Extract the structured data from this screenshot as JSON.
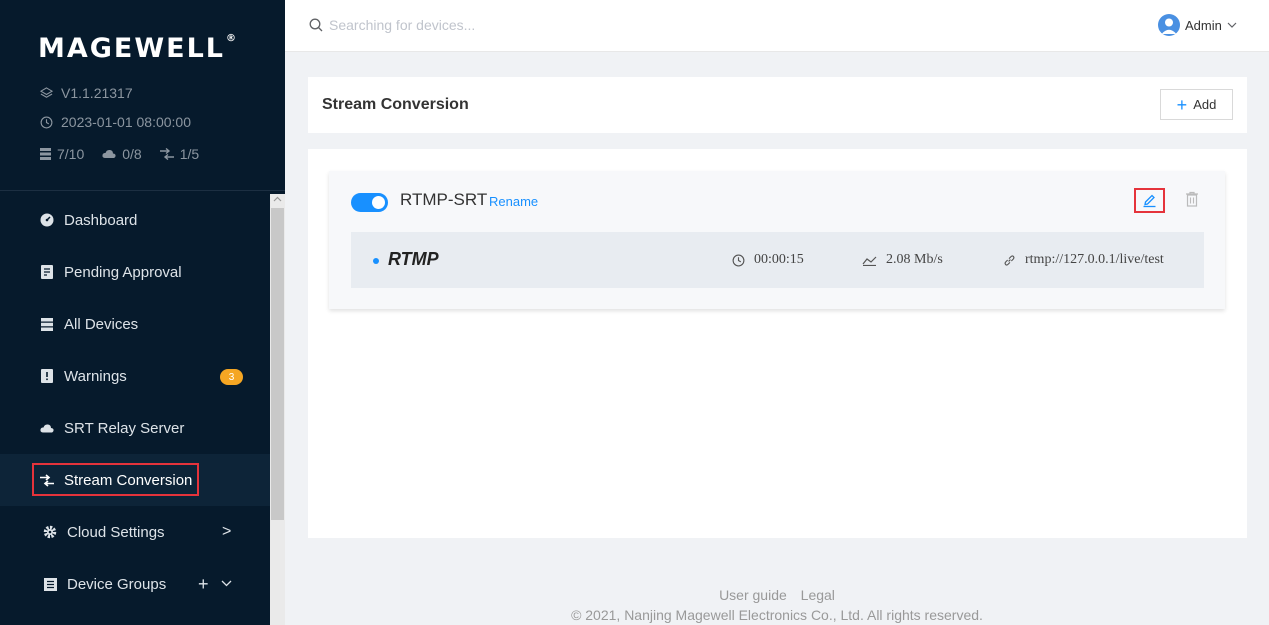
{
  "app": {
    "brand": "MAGEWELL",
    "brand_mark": "®",
    "version": "V1.1.21317",
    "datetime": "2023-01-01 08:00:00",
    "counts": {
      "devices": "7/10",
      "cloud": "0/8",
      "streams": "1/5"
    }
  },
  "sidebar": {
    "items": [
      {
        "label": "Dashboard",
        "icon": "dashboard-icon"
      },
      {
        "label": "Pending Approval",
        "icon": "pending-approval-icon"
      },
      {
        "label": "All Devices",
        "icon": "devices-icon"
      },
      {
        "label": "Warnings",
        "icon": "warning-icon",
        "badge": "3"
      },
      {
        "label": "SRT Relay Server",
        "icon": "cloud-icon"
      },
      {
        "label": "Stream Conversion",
        "icon": "stream-conversion-icon",
        "active": true
      },
      {
        "label": "Cloud Settings",
        "icon": "gear-icon",
        "trailing": ">"
      },
      {
        "label": "Device Groups",
        "icon": "device-groups-icon",
        "trailing_plus": "+"
      }
    ]
  },
  "topbar": {
    "search_placeholder": "Searching for devices...",
    "user_name": "Admin"
  },
  "page": {
    "title": "Stream Conversion",
    "add_label": "Add"
  },
  "task": {
    "enabled": true,
    "name": "RTMP-SRT",
    "rename_label": "Rename",
    "stream": {
      "protocol": "RTMP",
      "duration": "00:00:15",
      "bitrate": "2.08 Mb/s",
      "url": "rtmp://127.0.0.1/live/test"
    }
  },
  "footer": {
    "user_guide": "User guide",
    "legal": "Legal",
    "copyright": "© 2021, Nanjing Magewell Electronics Co., Ltd. All rights reserved."
  },
  "colors": {
    "sidebar_bg": "#061a2c",
    "accent": "#1890ff",
    "highlight_box": "#e5333b",
    "badge": "#f5a623"
  }
}
